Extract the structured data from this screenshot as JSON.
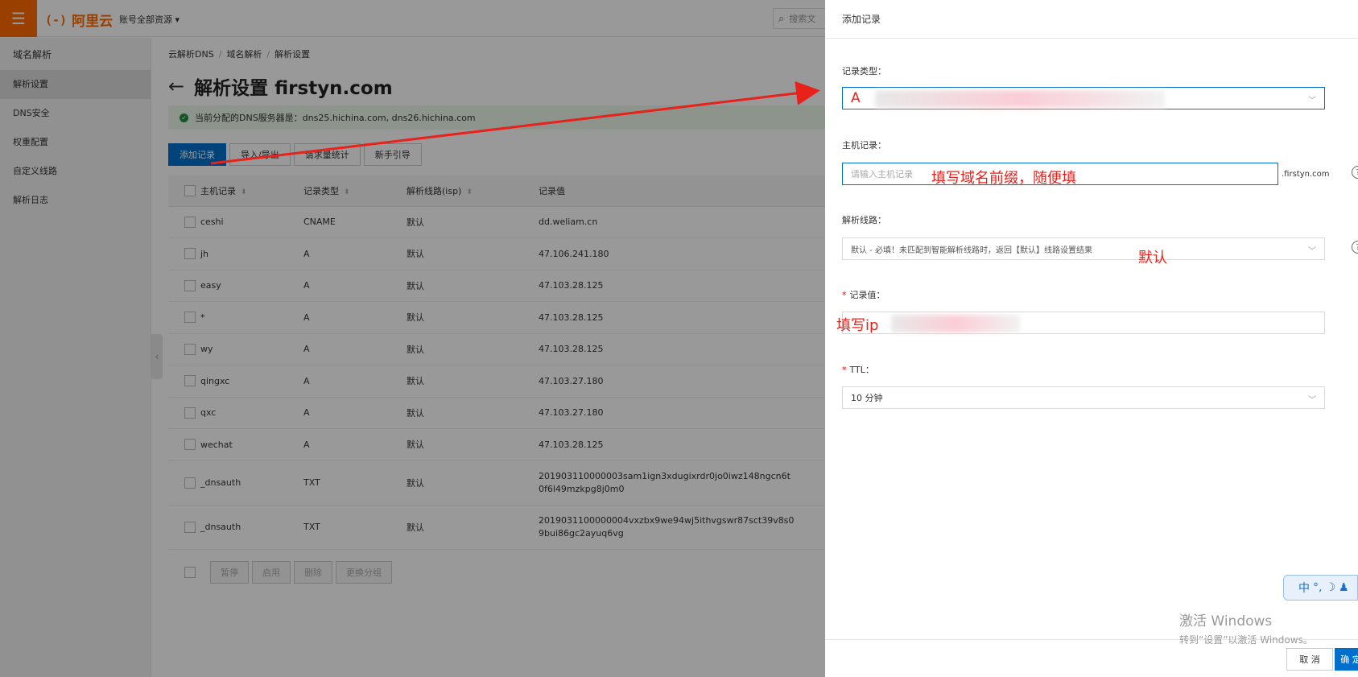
{
  "topbar": {
    "logo_mark": "(-)",
    "logo_text": "阿里云",
    "account_label": "账号全部资源",
    "search_placeholder": "搜索文"
  },
  "sidebar": {
    "title": "域名解析",
    "items": [
      {
        "label": "解析设置",
        "active": true
      },
      {
        "label": "DNS安全"
      },
      {
        "label": "权重配置"
      },
      {
        "label": "自定义线路"
      },
      {
        "label": "解析日志"
      }
    ]
  },
  "main": {
    "breadcrumb": [
      "云解析DNS",
      "域名解析",
      "解析设置"
    ],
    "title": "解析设置 firstyn.com",
    "notice": "当前分配的DNS服务器是：dns25.hichina.com, dns26.hichina.com",
    "toolbar": [
      "添加记录",
      "导入/导出",
      "请求量统计",
      "新手引导"
    ],
    "columns": [
      "主机记录",
      "记录类型",
      "解析线路(isp)",
      "记录值"
    ],
    "rows": [
      {
        "host": "ceshi",
        "type": "CNAME",
        "line": "默认",
        "value": "dd.weliam.cn",
        "value2": ""
      },
      {
        "host": "jh",
        "type": "A",
        "line": "默认",
        "value": "47.106.241.180",
        "value2": ""
      },
      {
        "host": "easy",
        "type": "A",
        "line": "默认",
        "value": "47.103.28.125",
        "value2": ""
      },
      {
        "host": "*",
        "type": "A",
        "line": "默认",
        "value": "47.103.28.125",
        "value2": ""
      },
      {
        "host": "wy",
        "type": "A",
        "line": "默认",
        "value": "47.103.28.125",
        "value2": ""
      },
      {
        "host": "qingxc",
        "type": "A",
        "line": "默认",
        "value": "47.103.27.180",
        "value2": ""
      },
      {
        "host": "qxc",
        "type": "A",
        "line": "默认",
        "value": "47.103.27.180",
        "value2": ""
      },
      {
        "host": "wechat",
        "type": "A",
        "line": "默认",
        "value": "47.103.28.125",
        "value2": ""
      },
      {
        "host": "_dnsauth",
        "type": "TXT",
        "line": "默认",
        "value": "201903110000003sam1ign3xdugixrdr0jo0iwz148ngcn6t",
        "value2": "0f6l49mzkpg8j0m0"
      },
      {
        "host": "_dnsauth",
        "type": "TXT",
        "line": "默认",
        "value": "2019031100000004vxzbx9we94wj5ithvgswr87sct39v8s0",
        "value2": "9bui86gc2ayuq6vg"
      }
    ],
    "bulk_actions": [
      "暂停",
      "启用",
      "删除",
      "更换分组"
    ]
  },
  "drawer": {
    "title": "添加记录",
    "record_type": {
      "label": "记录类型：",
      "value": "A"
    },
    "host": {
      "label": "主机记录：",
      "placeholder": "请输入主机记录",
      "suffix": ".firstyn.com"
    },
    "line": {
      "label": "解析线路：",
      "value": "默认 - 必填！未匹配到智能解析线路时，返回【默认】线路设置结果"
    },
    "record_value": {
      "label": "记录值："
    },
    "ttl": {
      "label": "TTL：",
      "value": "10 分钟"
    },
    "cancel_label": "取 消",
    "ok_label": "确 定"
  },
  "annotations": {
    "host_note": "填写域名前缀，随便填",
    "line_note": "默认",
    "value_note": "填写ip"
  },
  "watermark": {
    "line1": "激活 Windows",
    "line2": "转到“设置”以激活 Windows。"
  },
  "ime": {
    "label": "中"
  },
  "colors": {
    "brand": "#ff6a00",
    "primary": "#0070cc",
    "annotation": "#e8211b"
  }
}
